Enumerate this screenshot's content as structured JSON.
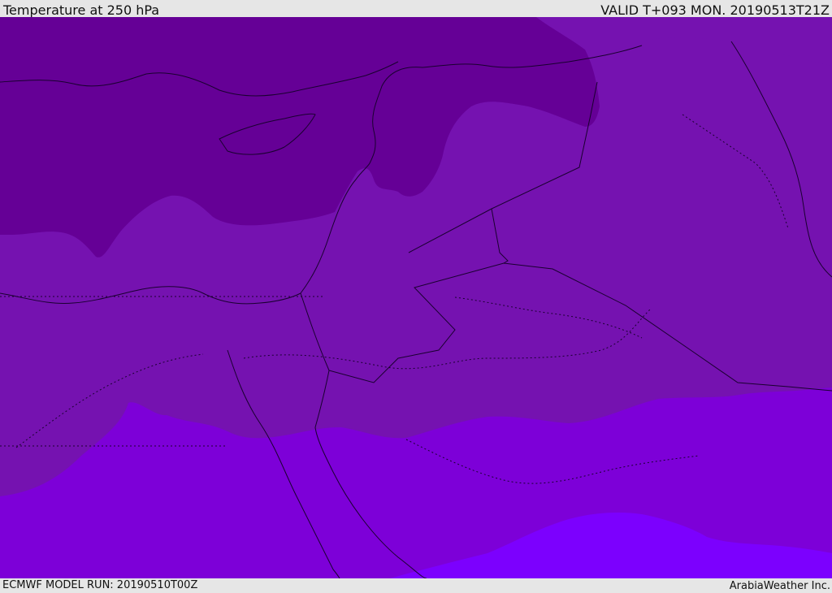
{
  "header": {
    "title": "Temperature at 250 hPa",
    "valid": "VALID T+093 MON. 20190513T21Z"
  },
  "footer": {
    "model_run": "ECMWF MODEL RUN: 20190510T00Z",
    "credit": "ArabiaWeather Inc."
  },
  "colors": {
    "coldest": "#650096",
    "cold": "#7512b0",
    "mid": "#7a0fbf",
    "warm": "#7d00d8",
    "warmest": "#7c00fe",
    "boundary": "#1a0030"
  }
}
